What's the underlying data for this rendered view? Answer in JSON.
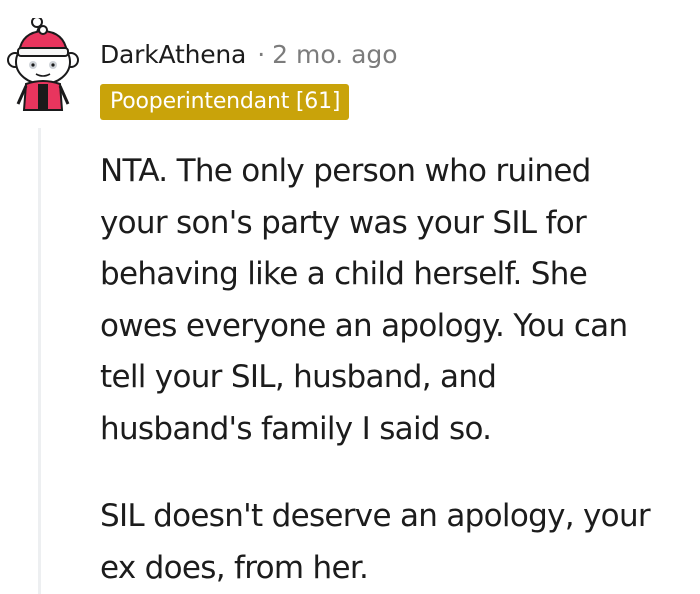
{
  "comment": {
    "author": "DarkAthena",
    "separator": "·",
    "timestamp": "2 mo. ago",
    "flair": "Pooperintendant [61]",
    "flair_color": "#c9a30a",
    "paragraphs": [
      {
        "lines": [
          "NTA. The only person who ruined",
          "your son's party was your SIL for",
          "behaving like a child herself. She",
          "owes everyone an apology. You can",
          "tell your SIL, husband, and",
          "husband's family I said so."
        ]
      },
      {
        "lines": [
          "SIL doesn't deserve an apology, your",
          "ex does, from her."
        ]
      }
    ]
  },
  "avatar": {
    "icon": "snoo-avatar-icon",
    "hat_color": "#e8355e",
    "outfit_color": "#e8355e"
  }
}
